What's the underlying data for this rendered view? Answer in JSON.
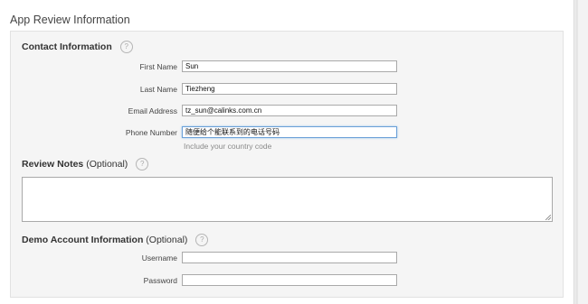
{
  "page": {
    "title": "App Review Information"
  },
  "contact": {
    "title": "Contact Information",
    "help_icon": "?",
    "fields": {
      "first_name": {
        "label": "First Name",
        "value": "Sun"
      },
      "last_name": {
        "label": "Last Name",
        "value": "Tiezheng"
      },
      "email": {
        "label": "Email Address",
        "value": "tz_sun@calinks.com.cn"
      },
      "phone": {
        "label": "Phone Number",
        "value": "随便给个能联系到的电话号码",
        "hint": "Include your country code"
      }
    }
  },
  "review_notes": {
    "title": "Review Notes",
    "optional": "(Optional)",
    "help_icon": "?",
    "value": ""
  },
  "demo_account": {
    "title": "Demo Account Information",
    "optional": "(Optional)",
    "help_icon": "?",
    "username": {
      "label": "Username",
      "value": ""
    },
    "password": {
      "label": "Password",
      "value": ""
    }
  }
}
